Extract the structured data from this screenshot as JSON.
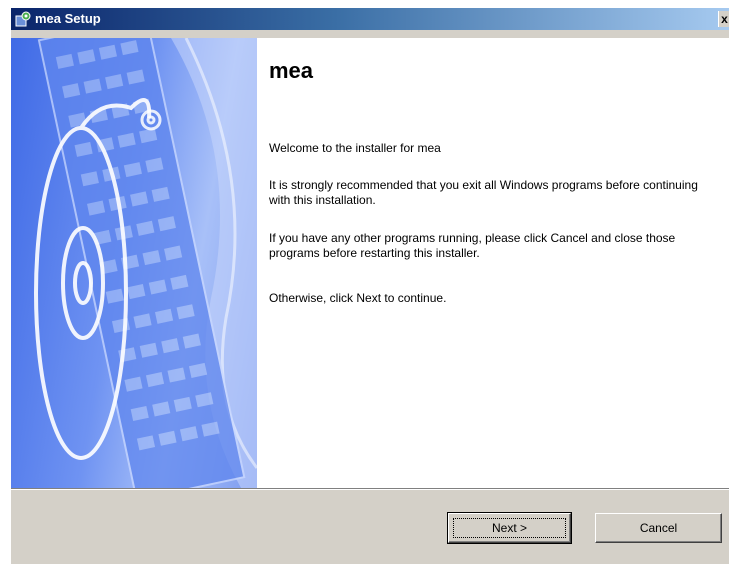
{
  "window": {
    "title": "mea Setup",
    "close_glyph": "x",
    "icon": "setup-app-icon"
  },
  "welcome": {
    "heading": "mea",
    "paragraphs": [
      "Welcome to the installer for mea",
      "It is strongly recommended that you exit all Windows programs before continuing with this installation.",
      "If you have any other programs running, please click Cancel and close those programs before restarting this installer.",
      "Otherwise, click Next to continue."
    ]
  },
  "buttons": {
    "next_label": "Next >",
    "cancel_label": "Cancel"
  },
  "colors": {
    "titlebar_start": "#0a246a",
    "titlebar_end": "#a6caf0",
    "dialog_face": "#d4d0c8",
    "banner_blue": "#5a82ee"
  }
}
